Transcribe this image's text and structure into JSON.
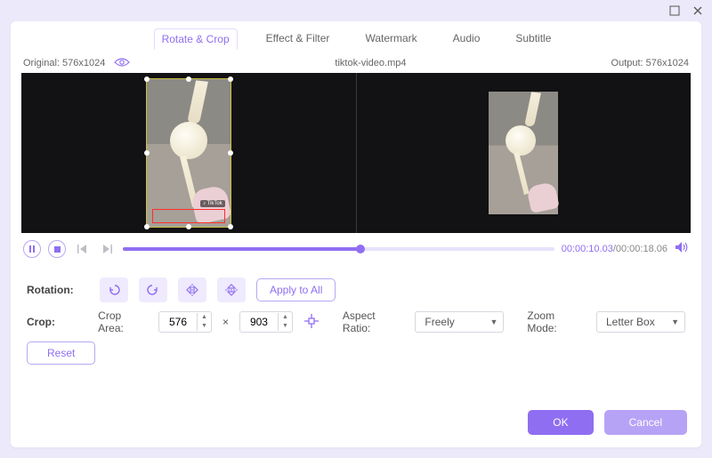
{
  "window": {
    "minimize_icon": "minimize-icon",
    "close_icon": "close-icon"
  },
  "tabs": [
    {
      "label": "Rotate & Crop",
      "active": true
    },
    {
      "label": "Effect & Filter",
      "active": false
    },
    {
      "label": "Watermark",
      "active": false
    },
    {
      "label": "Audio",
      "active": false
    },
    {
      "label": "Subtitle",
      "active": false
    }
  ],
  "info": {
    "original_label": "Original: 576x1024",
    "filename": "tiktok-video.mp4",
    "output_label": "Output: 576x1024",
    "eye_icon": "eye-icon"
  },
  "preview": {
    "tiktok_badge": "♪ TikTok",
    "progress_pct": 55
  },
  "transport": {
    "current_time": "00:00:10.03",
    "total_time": "/00:00:18.06"
  },
  "rotation": {
    "label": "Rotation:",
    "apply_all": "Apply to All"
  },
  "crop": {
    "label": "Crop:",
    "area_label": "Crop Area:",
    "width": "576",
    "times": "×",
    "height": "903",
    "aspect_label": "Aspect Ratio:",
    "aspect_value": "Freely",
    "zoom_label": "Zoom Mode:",
    "zoom_value": "Letter Box",
    "reset": "Reset"
  },
  "footer": {
    "ok": "OK",
    "cancel": "Cancel"
  }
}
